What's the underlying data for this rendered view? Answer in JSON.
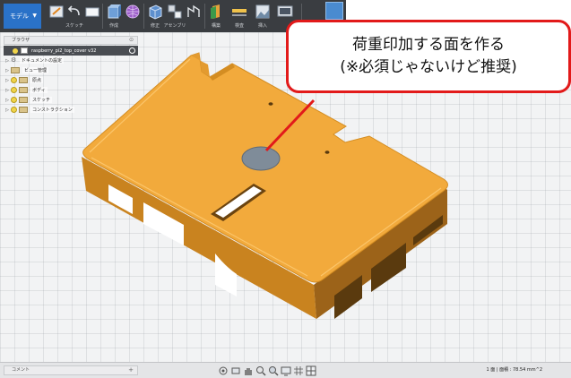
{
  "toolbar": {
    "workspace": "モデル",
    "tools": [
      {
        "label": "",
        "icon": "sketch-edit-icon"
      },
      {
        "label": "",
        "icon": "undo-icon"
      },
      {
        "label": "スケッチ",
        "icon": "sketch-rectangle-icon"
      },
      {
        "label": "",
        "icon": "box-icon"
      },
      {
        "label": "作成",
        "icon": "sphere-mesh-icon"
      },
      {
        "label": "",
        "icon": "cube-icon"
      },
      {
        "label": "修正",
        "icon": "modify-icon"
      },
      {
        "label": "アセンブリ",
        "icon": "assembly-icon"
      },
      {
        "label": "",
        "icon": "joint-icon"
      },
      {
        "label": "構築",
        "icon": "construct-plane-icon"
      },
      {
        "label": "検査",
        "icon": "measure-icon"
      },
      {
        "label": "挿入",
        "icon": "insert-image-icon"
      },
      {
        "label": "",
        "icon": "make-icon"
      },
      {
        "label": "",
        "icon": "select-icon"
      }
    ]
  },
  "browser": {
    "title": "ブラウザ",
    "root": "raspberry_pi2_top_cover v32",
    "items": [
      {
        "label": "ドキュメントの設定",
        "icon": "gear-icon"
      },
      {
        "label": "ビュー管理",
        "icon": "folder-icon"
      },
      {
        "label": "原点",
        "icon": "folder-icon"
      },
      {
        "label": "ボディ",
        "icon": "folder-icon"
      },
      {
        "label": "スケッチ",
        "icon": "folder-icon"
      },
      {
        "label": "コンストラクション",
        "icon": "folder-icon"
      }
    ]
  },
  "callout": {
    "line1": "荷重印加する面を作る",
    "line2": "(※必須じゃないけど推奨)"
  },
  "statusbar": {
    "comments_label": "コメント",
    "readout": "1 面 | 面積 : 78.54 mm^2"
  },
  "colors": {
    "toolbar_bg": "#3a3d41",
    "part_top": "#f2aa3c",
    "part_front": "#c9831f",
    "part_side": "#a3661a",
    "selected_face": "#7f8c99",
    "callout_border": "#e21a1a",
    "workspace_button": "#2a72c8"
  }
}
